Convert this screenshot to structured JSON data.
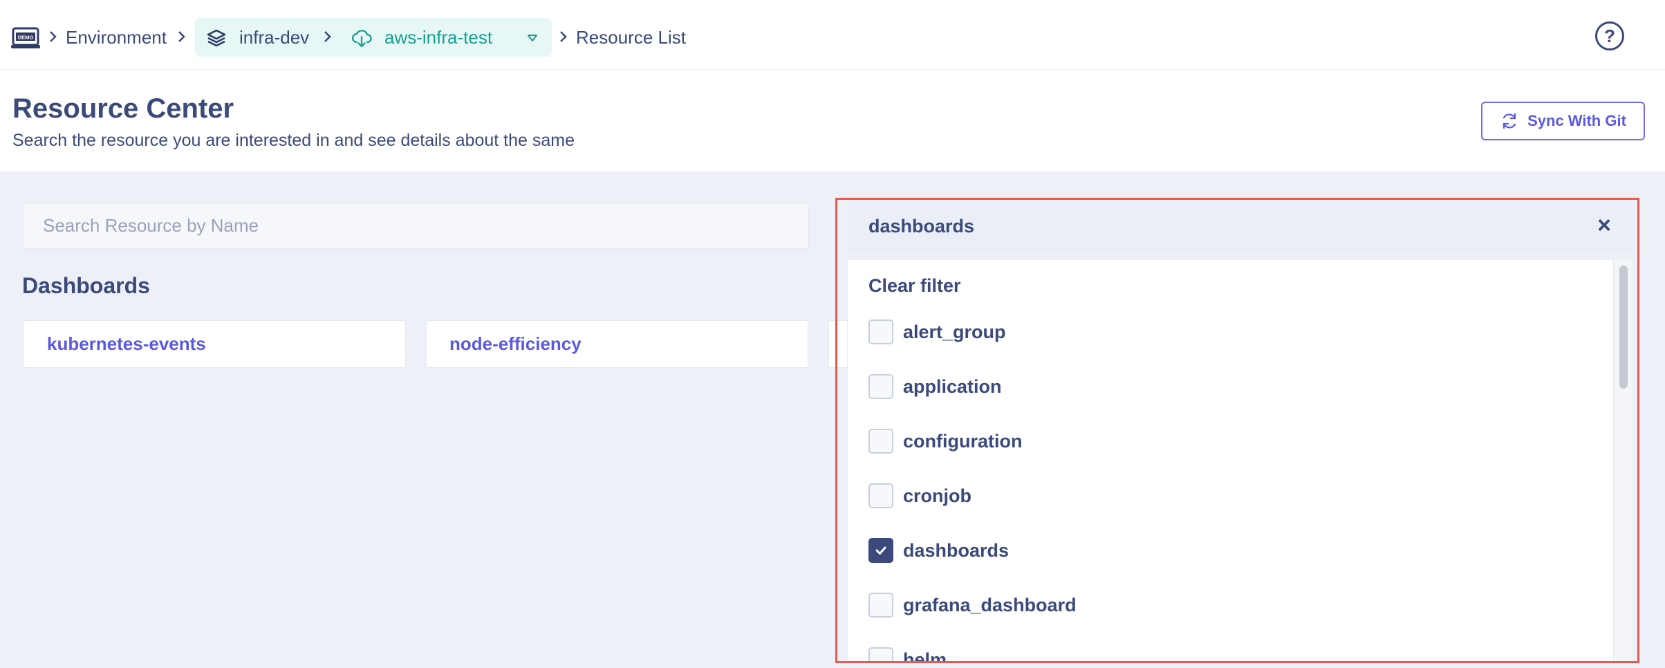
{
  "breadcrumb": {
    "logo_text": "DEMO",
    "environment": "Environment",
    "project": "infra-dev",
    "environment_name": "aws-infra-test",
    "current": "Resource List"
  },
  "help": {
    "label": "?"
  },
  "header": {
    "title": "Resource Center",
    "subtitle": "Search the resource you are interested in and see details about the same",
    "sync_button": "Sync With Git"
  },
  "search": {
    "placeholder": "Search Resource by Name",
    "value": ""
  },
  "section": {
    "title": "Dashboards"
  },
  "cards": [
    "kubernetes-events",
    "node-efficiency"
  ],
  "filter_panel": {
    "selected": "dashboards",
    "clear_label": "Clear filter",
    "close_label": "×",
    "options": [
      {
        "label": "alert_group",
        "checked": false
      },
      {
        "label": "application",
        "checked": false
      },
      {
        "label": "configuration",
        "checked": false
      },
      {
        "label": "cronjob",
        "checked": false
      },
      {
        "label": "dashboards",
        "checked": true
      },
      {
        "label": "grafana_dashboard",
        "checked": false
      },
      {
        "label": "helm",
        "checked": false
      }
    ]
  },
  "colors": {
    "text": "#3b4a7a",
    "accent": "#5b59e0",
    "teal": "#1a9e8f",
    "highlight_border": "#ec5a4f"
  }
}
